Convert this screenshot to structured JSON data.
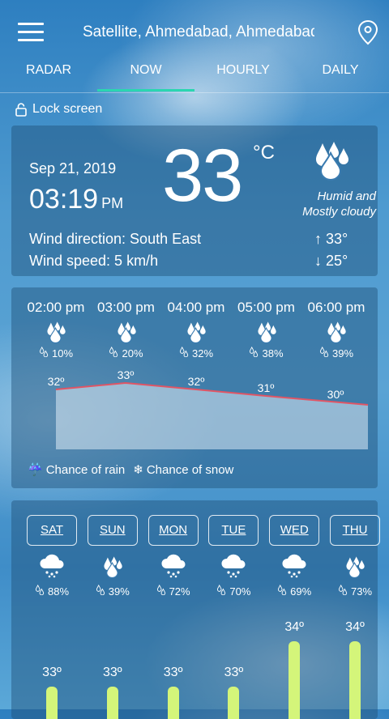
{
  "header": {
    "location": "Satellite, Ahmedabad, Ahmedabad"
  },
  "tabs": [
    "RADAR",
    "NOW",
    "HOURLY",
    "DAILY"
  ],
  "active_tab": "NOW",
  "lock_label": "Lock screen",
  "current": {
    "date": "Sep 21, 2019",
    "time": "03:19",
    "ampm": "PM",
    "temp": "33",
    "unit": "°C",
    "condition_line1": "Humid and",
    "condition_line2": "Mostly cloudy",
    "wind_direction": "Wind direction: South East",
    "wind_speed": "Wind speed: 5 km/h",
    "high": "33°",
    "low": "25°",
    "condition_icon": "humid-drops-icon"
  },
  "hourly": [
    {
      "time": "02:00 pm",
      "chance": "10%",
      "temp": "32º"
    },
    {
      "time": "03:00 pm",
      "chance": "20%",
      "temp": "33º"
    },
    {
      "time": "04:00 pm",
      "chance": "32%",
      "temp": "32º"
    },
    {
      "time": "05:00 pm",
      "chance": "38%",
      "temp": "31º"
    },
    {
      "time": "06:00 pm",
      "chance": "39%",
      "temp": "30º"
    }
  ],
  "hourly_temps": [
    32,
    33,
    32,
    31,
    30
  ],
  "legend": {
    "rain": "Chance of rain",
    "snow": "Chance of snow"
  },
  "daily": [
    {
      "day": "SAT",
      "icon": "rain-cloud-icon",
      "chance": "88%",
      "high": "33º"
    },
    {
      "day": "SUN",
      "icon": "humid-drops-icon",
      "chance": "39%",
      "high": "33º"
    },
    {
      "day": "MON",
      "icon": "rain-cloud-icon",
      "chance": "72%",
      "high": "33º"
    },
    {
      "day": "TUE",
      "icon": "rain-cloud-icon",
      "chance": "70%",
      "high": "33º"
    },
    {
      "day": "WED",
      "icon": "rain-cloud-icon",
      "chance": "69%",
      "high": "34º"
    },
    {
      "day": "THU",
      "icon": "humid-drops-icon",
      "chance": "73%",
      "high": "34º"
    }
  ],
  "daily_highs": [
    33,
    33,
    33,
    33,
    34,
    34
  ],
  "colors": {
    "accent": "#2bd6b0",
    "temp_line": "#e05565",
    "bar": "#d4f57a"
  }
}
